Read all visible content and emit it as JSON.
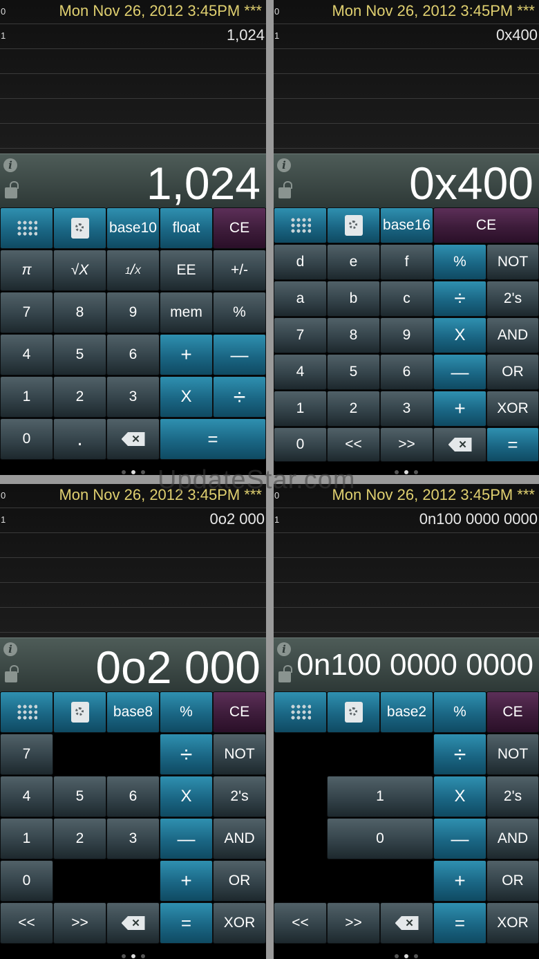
{
  "watermark": "UpdateStar.com",
  "panels": {
    "dec": {
      "tape_row0": "0",
      "tape_row1": "1",
      "date": "Mon Nov 26, 2012 3:45PM ***",
      "tape_value": "1,024",
      "display_value": "1,024",
      "keys": {
        "base": "base10",
        "mode": "float",
        "ce": "CE",
        "pi": "π",
        "sqrt": "√X",
        "recip_num": "1",
        "recip_den": "X",
        "ee": "EE",
        "sign": "+/-",
        "d7": "7",
        "d8": "8",
        "d9": "9",
        "mem": "mem",
        "pct": "%",
        "d4": "4",
        "d5": "5",
        "d6": "6",
        "plus": "+",
        "minus": "—",
        "d1": "1",
        "d2": "2",
        "d3": "3",
        "times": "X",
        "div": "÷",
        "d0": "0",
        "dot": ".",
        "eq": "="
      }
    },
    "hex": {
      "tape_row0": "0",
      "tape_row1": "1",
      "date": "Mon Nov 26, 2012 3:45PM ***",
      "tape_value": "0x400",
      "display_value": "0x400",
      "keys": {
        "base": "base16",
        "ce": "CE",
        "d": "d",
        "e": "e",
        "f": "f",
        "pct": "%",
        "not": "NOT",
        "a": "a",
        "b": "b",
        "c": "c",
        "div": "÷",
        "twos": "2's",
        "d7": "7",
        "d8": "8",
        "d9": "9",
        "times": "X",
        "and": "AND",
        "d4": "4",
        "d5": "5",
        "d6": "6",
        "minus": "—",
        "or": "OR",
        "d1": "1",
        "d2": "2",
        "d3": "3",
        "plus": "+",
        "xor": "XOR",
        "d0": "0",
        "shl": "<<",
        "shr": ">>",
        "eq": "="
      }
    },
    "oct": {
      "tape_row0": "0",
      "tape_row1": "1",
      "date": "Mon Nov 26, 2012 3:45PM ***",
      "tape_value": "0o2 000",
      "display_value": "0o2 000",
      "keys": {
        "base": "base8",
        "pct": "%",
        "ce": "CE",
        "d7": "7",
        "div": "÷",
        "not": "NOT",
        "d4": "4",
        "d5": "5",
        "d6": "6",
        "times": "X",
        "twos": "2's",
        "d1": "1",
        "d2": "2",
        "d3": "3",
        "minus": "—",
        "and": "AND",
        "d0": "0",
        "plus": "+",
        "or": "OR",
        "shl": "<<",
        "shr": ">>",
        "eq": "=",
        "xor": "XOR"
      }
    },
    "bin": {
      "tape_row0": "0",
      "tape_row1": "1",
      "date": "Mon Nov 26, 2012 3:45PM ***",
      "tape_value": "0n100 0000 0000",
      "display_value": "0n100 0000 0000",
      "keys": {
        "base": "base2",
        "pct": "%",
        "ce": "CE",
        "div": "÷",
        "not": "NOT",
        "d1": "1",
        "times": "X",
        "twos": "2's",
        "d0": "0",
        "minus": "—",
        "and": "AND",
        "plus": "+",
        "or": "OR",
        "shl": "<<",
        "shr": ">>",
        "eq": "=",
        "xor": "XOR"
      }
    }
  },
  "page_dots": {
    "count": 3,
    "active_index": 1
  }
}
